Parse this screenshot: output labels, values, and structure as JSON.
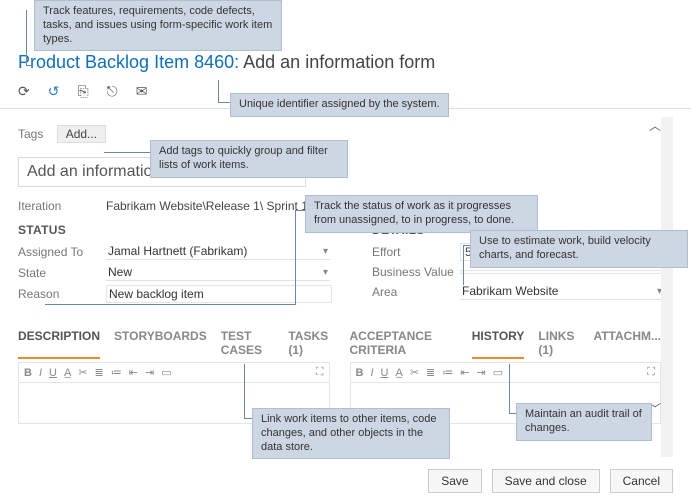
{
  "callouts": {
    "types": "Track features, requirements, code defects, tasks, and issues using form-specific work item types.",
    "uid": "Unique identifier assigned by the system.",
    "tags": "Add tags to quickly group and filter lists of work items.",
    "status": "Track the status of work as it progresses from unassigned, to in progress, to done.",
    "estimate": "Use to estimate work, build velocity charts, and forecast.",
    "links": "Link work items to other items, code changes, and other objects in the data store.",
    "history": "Maintain an audit trail of changes."
  },
  "title": {
    "prefix": "Product Backlog Item 8460:",
    "text": "Add an information form"
  },
  "tags": {
    "label": "Tags",
    "add": "Add..."
  },
  "bigTitle": "Add an information form",
  "iteration": {
    "label": "Iteration",
    "value": "Fabrikam Website\\Release 1\\ Sprint 1"
  },
  "sections": {
    "status": "STATUS",
    "details": "DETAILS"
  },
  "status": {
    "assignedLabel": "Assigned To",
    "assignedValue": "Jamal Hartnett (Fabrikam)",
    "stateLabel": "State",
    "stateValue": "New",
    "reasonLabel": "Reason",
    "reasonPlaceholder": "New backlog item"
  },
  "details": {
    "effortLabel": "Effort",
    "effortValue": "5",
    "bvLabel": "Business Value",
    "bvValue": "",
    "areaLabel": "Area",
    "areaValue": "Fabrikam Website"
  },
  "leftTabs": {
    "t1": "DESCRIPTION",
    "t2": "STORYBOARDS",
    "t3": "TEST CASES",
    "t4": "TASKS (1)"
  },
  "rightTabs": {
    "t1": "ACCEPTANCE CRITERIA",
    "t2": "HISTORY",
    "t3": "LINKS (1)",
    "t4": "ATTACHM..."
  },
  "buttons": {
    "save": "Save",
    "saveClose": "Save and close",
    "cancel": "Cancel"
  },
  "rt": {
    "bold": "B",
    "italic": "I",
    "underline": "U"
  }
}
